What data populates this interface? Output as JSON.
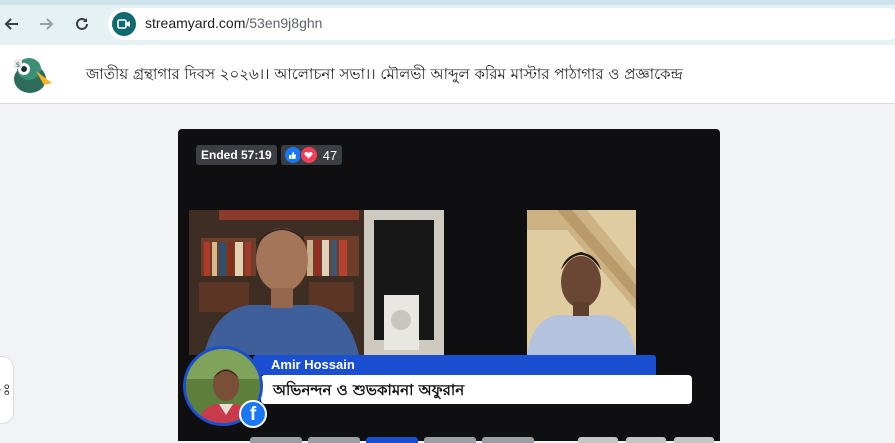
{
  "browser": {
    "url_host": "streamyard.com",
    "url_path": "/53en9j8ghn",
    "icons": [
      "back-arrow-icon",
      "forward-arrow-icon",
      "reload-icon",
      "site-camera-icon"
    ]
  },
  "header": {
    "title": "জাতীয় গ্রন্থাগার দিবস ২০২৬।। আলোচনা সভা।। মৌলভী আব্দুল করিম মাস্টার পাঠাগার ও প্রজ্ঞাকেন্দ্র",
    "logo_icon": "streamyard-duck-logo"
  },
  "stream": {
    "status": "Ended 57:19",
    "reaction_count": "47",
    "reactions": [
      "like-icon",
      "love-icon"
    ]
  },
  "lower_third": {
    "name": "Amir Hossain",
    "message": "অভিনন্দন ও শুভকামনা অফুরান",
    "platform_icon": "facebook-icon"
  },
  "left_tab": {
    "glyph": "ঃ"
  },
  "colors": {
    "accent_blue": "#1b4fd1",
    "stage_bg": "#0f0f11",
    "site_icon_teal": "#0e6a6f"
  }
}
